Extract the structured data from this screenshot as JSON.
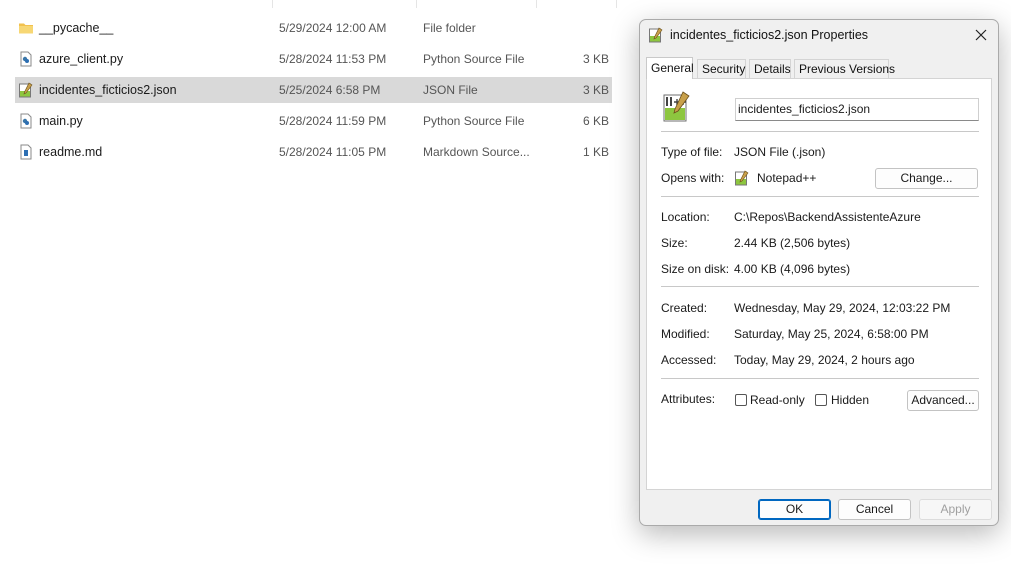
{
  "files": [
    {
      "name": "__pycache__",
      "date": "5/29/2024 12:00 AM",
      "type": "File folder",
      "size": "",
      "icon": "folder-icon",
      "selected": false
    },
    {
      "name": "azure_client.py",
      "date": "5/28/2024 11:53 PM",
      "type": "Python Source File",
      "size": "3 KB",
      "icon": "python-file-icon",
      "selected": false
    },
    {
      "name": "incidentes_ficticios2.json",
      "date": "5/25/2024 6:58 PM",
      "type": "JSON File",
      "size": "3 KB",
      "icon": "notepad-plus-plus-icon",
      "selected": true
    },
    {
      "name": "main.py",
      "date": "5/28/2024 11:59 PM",
      "type": "Python Source File",
      "size": "6 KB",
      "icon": "python-file-icon",
      "selected": false
    },
    {
      "name": "readme.md",
      "date": "5/28/2024 11:05 PM",
      "type": "Markdown Source...",
      "size": "1 KB",
      "icon": "markdown-file-icon",
      "selected": false
    }
  ],
  "dialog": {
    "title": "incidentes_ficticios2.json Properties",
    "tabs": [
      "General",
      "Security",
      "Details",
      "Previous Versions"
    ],
    "active_tab": "General",
    "filename": "incidentes_ficticios2.json",
    "type_label": "Type of file:",
    "type_value": "JSON File (.json)",
    "opens_label": "Opens with:",
    "opens_value": "Notepad++",
    "change_button": "Change...",
    "location_label": "Location:",
    "location_value": "C:\\Repos\\BackendAssistenteAzure",
    "size_label": "Size:",
    "size_value": "2.44 KB (2,506 bytes)",
    "size_disk_label": "Size on disk:",
    "size_disk_value": "4.00 KB (4,096 bytes)",
    "created_label": "Created:",
    "created_value": "Wednesday, May 29, 2024, 12:03:22 PM",
    "modified_label": "Modified:",
    "modified_value": "Saturday, May 25, 2024, 6:58:00 PM",
    "accessed_label": "Accessed:",
    "accessed_value": "Today, May 29, 2024, 2 hours ago",
    "attributes_label": "Attributes:",
    "readonly_label": "Read-only",
    "readonly_checked": false,
    "hidden_label": "Hidden",
    "hidden_checked": false,
    "advanced_button": "Advanced...",
    "ok_button": "OK",
    "cancel_button": "Cancel",
    "apply_button": "Apply"
  },
  "colors": {
    "selection": "#d9d9d9",
    "folder": "#f2c14e",
    "accent": "#0067c0",
    "dialog_bg": "#f0f0f0"
  }
}
